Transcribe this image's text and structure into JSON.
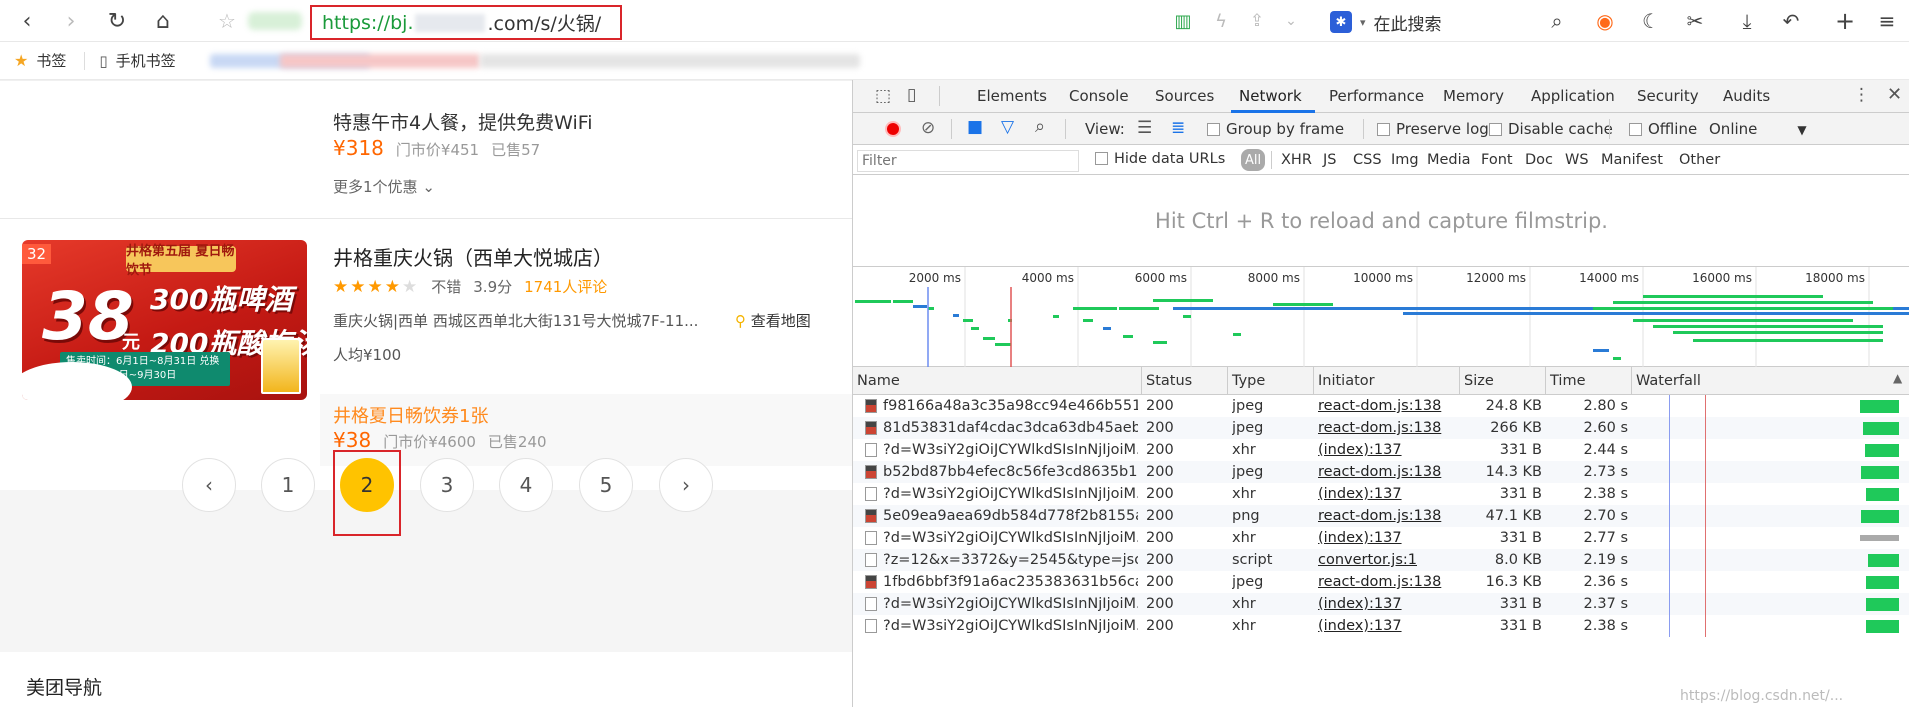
{
  "browser": {
    "url_prefix": "https://bj.",
    "url_suffix": ".com/s/火锅/",
    "search_placeholder": "在此搜索",
    "bookmark_label": "书签",
    "mobile_bookmark_label": "手机书签"
  },
  "page": {
    "top_deal": {
      "title": "特惠午市4人餐，提供免费WiFi",
      "price": "¥318",
      "original_price": "门市价¥451",
      "sold": "已售57",
      "more": "更多1个优惠"
    },
    "shop": {
      "promo_badge": "32",
      "promo_ribbon": "井格第五届 夏日畅饮节",
      "promo_big": "38",
      "promo_unit": "元",
      "promo_line1": "300瓶啤酒",
      "promo_line2": "200瓶酸梅汤",
      "promo_dates": "售卖时间：6月1日~8月31日 兑换时间：6月1日~9月30日",
      "name": "井格重庆火锅（西单大悦城店）",
      "rating_word": "不错",
      "rating_score": "3.9分",
      "rating": 3.9,
      "reviews": "1741人评论",
      "address": "重庆火锅|西单    西城区西单北大街131号大悦城7F-11...",
      "map_link": "查看地图",
      "avg_price": "人均¥100",
      "coupon_title": "井格夏日畅饮券1张",
      "coupon_price": "¥38",
      "coupon_original": "门市价¥4600",
      "coupon_sold": "已售240"
    },
    "pagination": {
      "prev": "‹",
      "next": "›",
      "pages": [
        "1",
        "2",
        "3",
        "4",
        "5"
      ],
      "active": "2"
    },
    "nav_title": "美团导航"
  },
  "devtools": {
    "tabs": [
      "Elements",
      "Console",
      "Sources",
      "Network",
      "Performance",
      "Memory",
      "Application",
      "Security",
      "Audits"
    ],
    "active_tab": "Network",
    "view_label": "View:",
    "group_by_frame": "Group by frame",
    "preserve_log": "Preserve log",
    "disable_cache": "Disable cache",
    "offline": "Offline",
    "online": "Online",
    "filter_placeholder": "Filter",
    "hide_data_urls": "Hide data URLs",
    "type_filters": [
      "All",
      "XHR",
      "JS",
      "CSS",
      "Img",
      "Media",
      "Font",
      "Doc",
      "WS",
      "Manifest",
      "Other"
    ],
    "filmstrip_message": "Hit Ctrl + R to reload and capture filmstrip.",
    "overview_ticks": [
      "2000 ms",
      "4000 ms",
      "6000 ms",
      "8000 ms",
      "10000 ms",
      "12000 ms",
      "14000 ms",
      "16000 ms",
      "18000 ms"
    ],
    "columns": [
      "Name",
      "Status",
      "Type",
      "Initiator",
      "Size",
      "Time",
      "Waterfall"
    ],
    "rows": [
      {
        "name": "f98166a48a3c35a98cc94e466b5511...",
        "status": "200",
        "type": "jpeg",
        "initiator": "react-dom.js:138",
        "size": "24.8 KB",
        "time": "2.80 s",
        "icon": "image-file-icon"
      },
      {
        "name": "81d53831daf4cdac3dca63db45aeb8...",
        "status": "200",
        "type": "jpeg",
        "initiator": "react-dom.js:138",
        "size": "266 KB",
        "time": "2.60 s",
        "icon": "image-file-icon"
      },
      {
        "name": "?d=W3siY2giOiJCYWlkdSIsInNjIjoiM...",
        "status": "200",
        "type": "xhr",
        "initiator": "(index):137",
        "size": "331 B",
        "time": "2.44 s",
        "icon": "document-file-icon"
      },
      {
        "name": "b52bd87bb4efec8c56fe3cd8635b1c...",
        "status": "200",
        "type": "jpeg",
        "initiator": "react-dom.js:138",
        "size": "14.3 KB",
        "time": "2.73 s",
        "icon": "image-file-icon"
      },
      {
        "name": "?d=W3siY2giOiJCYWlkdSIsInNjIjoiM...",
        "status": "200",
        "type": "xhr",
        "initiator": "(index):137",
        "size": "331 B",
        "time": "2.38 s",
        "icon": "document-file-icon"
      },
      {
        "name": "5e09ea9aea69db584d778f2b8155a7...",
        "status": "200",
        "type": "png",
        "initiator": "react-dom.js:138",
        "size": "47.1 KB",
        "time": "2.70 s",
        "icon": "image-file-icon"
      },
      {
        "name": "?d=W3siY2giOiJCYWlkdSIsInNjIjoiM...",
        "status": "200",
        "type": "xhr",
        "initiator": "(index):137",
        "size": "331 B",
        "time": "2.77 s",
        "icon": "document-file-icon"
      },
      {
        "name": "?z=12&x=3372&y=2545&type=jso...",
        "status": "200",
        "type": "script",
        "initiator": "convertor.js:1",
        "size": "8.0 KB",
        "time": "2.19 s",
        "icon": "script-file-icon"
      },
      {
        "name": "1fbd6bbf3f91a6ac235383631b56ca...",
        "status": "200",
        "type": "jpeg",
        "initiator": "react-dom.js:138",
        "size": "16.3 KB",
        "time": "2.36 s",
        "icon": "image-file-icon"
      },
      {
        "name": "?d=W3siY2giOiJCYWlkdSIsInNjIjoiM...",
        "status": "200",
        "type": "xhr",
        "initiator": "(index):137",
        "size": "331 B",
        "time": "2.37 s",
        "icon": "document-file-icon"
      },
      {
        "name": "?d=W3siY2giOiJCYWlkdSIsInNjIjoiM...",
        "status": "200",
        "type": "xhr",
        "initiator": "(index):137",
        "size": "331 B",
        "time": "2.38 s",
        "icon": "document-file-icon"
      }
    ],
    "watermark": "https://blog.csdn.net/..."
  },
  "colors": {
    "accent_orange": "#ff6600",
    "highlight_red": "#d9252a",
    "active_page": "#ffc300",
    "devtools_blue": "#1a73e8",
    "waterfall_green": "#1fc95a"
  }
}
